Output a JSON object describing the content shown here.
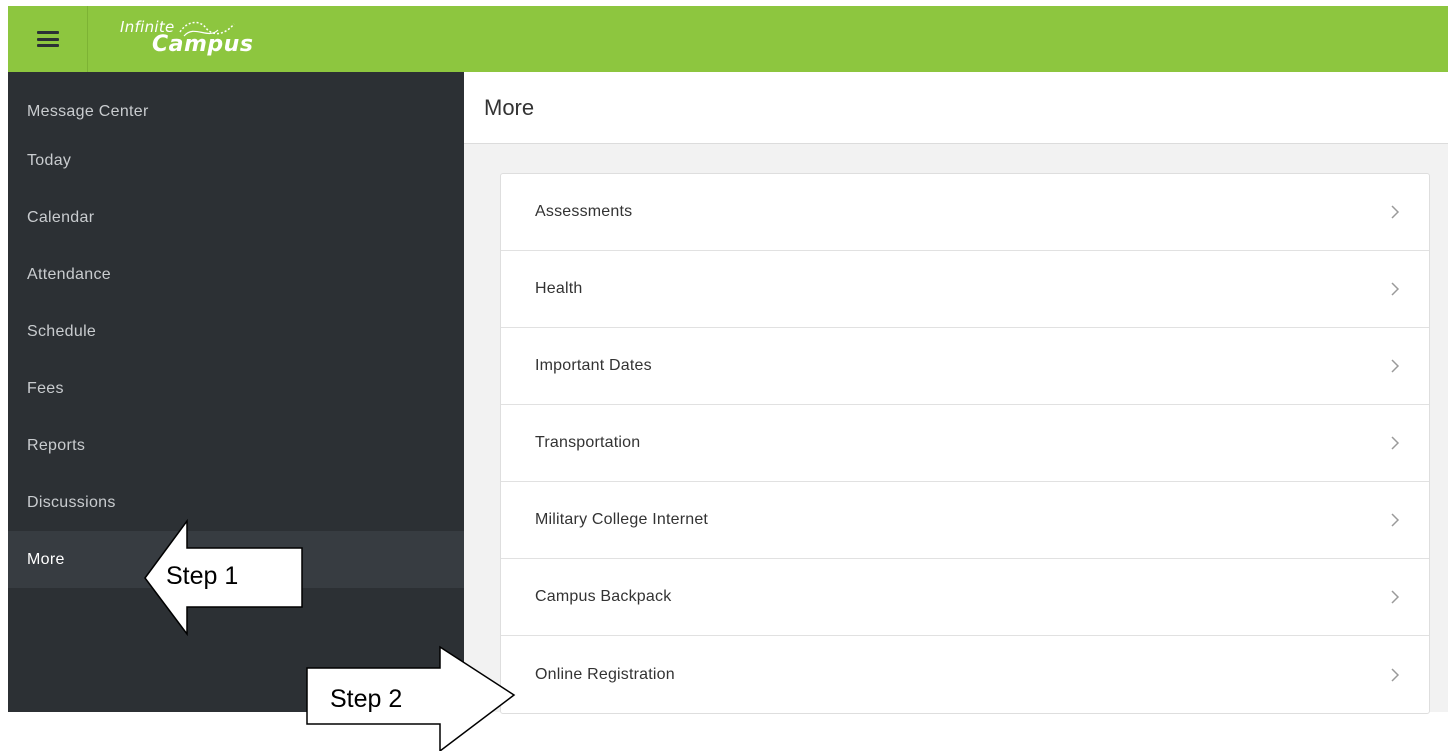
{
  "header": {
    "logo_top": "Infinite",
    "logo_bottom": "Campus",
    "menu_icon": "hamburger-menu-icon",
    "bar_color": "#8dc63f"
  },
  "sidebar": {
    "bg_color": "#2c3034",
    "items": [
      {
        "label": "Message Center"
      },
      {
        "label": "Today"
      },
      {
        "label": "Calendar"
      },
      {
        "label": "Attendance"
      },
      {
        "label": "Schedule"
      },
      {
        "label": "Fees"
      },
      {
        "label": "Reports"
      },
      {
        "label": "Discussions"
      },
      {
        "label": "More",
        "active": true
      }
    ]
  },
  "main": {
    "title": "More",
    "items": [
      {
        "label": "Assessments",
        "icon": "chevron-right-icon"
      },
      {
        "label": "Health",
        "icon": "chevron-right-icon"
      },
      {
        "label": "Important Dates",
        "icon": "chevron-right-icon"
      },
      {
        "label": "Transportation",
        "icon": "chevron-right-icon"
      },
      {
        "label": "Military College Internet",
        "icon": "chevron-right-icon"
      },
      {
        "label": "Campus Backpack",
        "icon": "chevron-right-icon"
      },
      {
        "label": "Online Registration",
        "icon": "chevron-right-icon"
      }
    ]
  },
  "annotations": {
    "step1": "Step 1",
    "step2": "Step 2"
  }
}
